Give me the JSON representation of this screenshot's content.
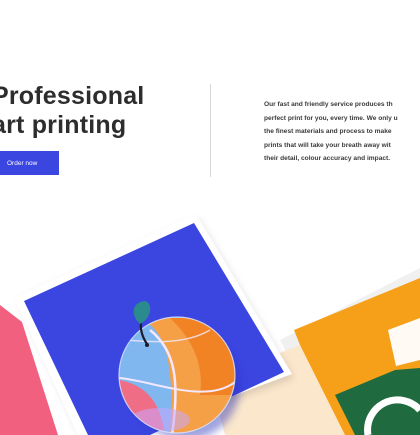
{
  "hero": {
    "title_line1": "Professional",
    "title_line2": "art printing",
    "cta_label": "Order now"
  },
  "description": {
    "lines": [
      "Our fast and friendly service produces th",
      "perfect print for you, every time. We only u",
      "the finest materials and process to make",
      "prints that will take your breath away wit",
      "their detail, colour accuracy and impact."
    ]
  },
  "colors": {
    "accent_blue": "#3b45e0",
    "pink": "#f2607f",
    "orange": "#f6a01a",
    "green": "#1f6a3f",
    "cream": "#fbe7cc"
  }
}
